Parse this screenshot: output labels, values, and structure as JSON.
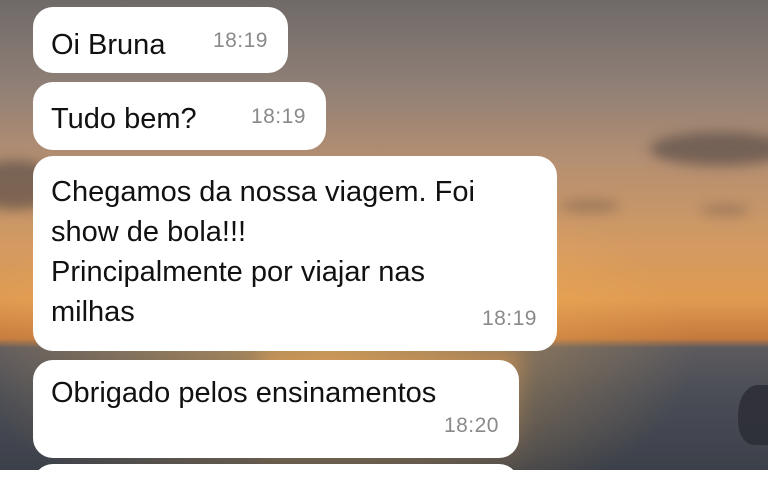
{
  "messages": [
    {
      "text": "Oi Bruna",
      "time": "18:19"
    },
    {
      "text": "Tudo bem?",
      "time": "18:19"
    },
    {
      "text": "Chegamos da nossa viagem. Foi\nshow de bola!!!\nPrincipalmente por viajar nas\nmilhas",
      "time": "18:19"
    },
    {
      "text": "Obrigado pelos ensinamentos",
      "time": "18:20"
    }
  ],
  "colors": {
    "bubble": "#ffffff",
    "text": "#111111",
    "timestamp": "#8a8a8d"
  }
}
